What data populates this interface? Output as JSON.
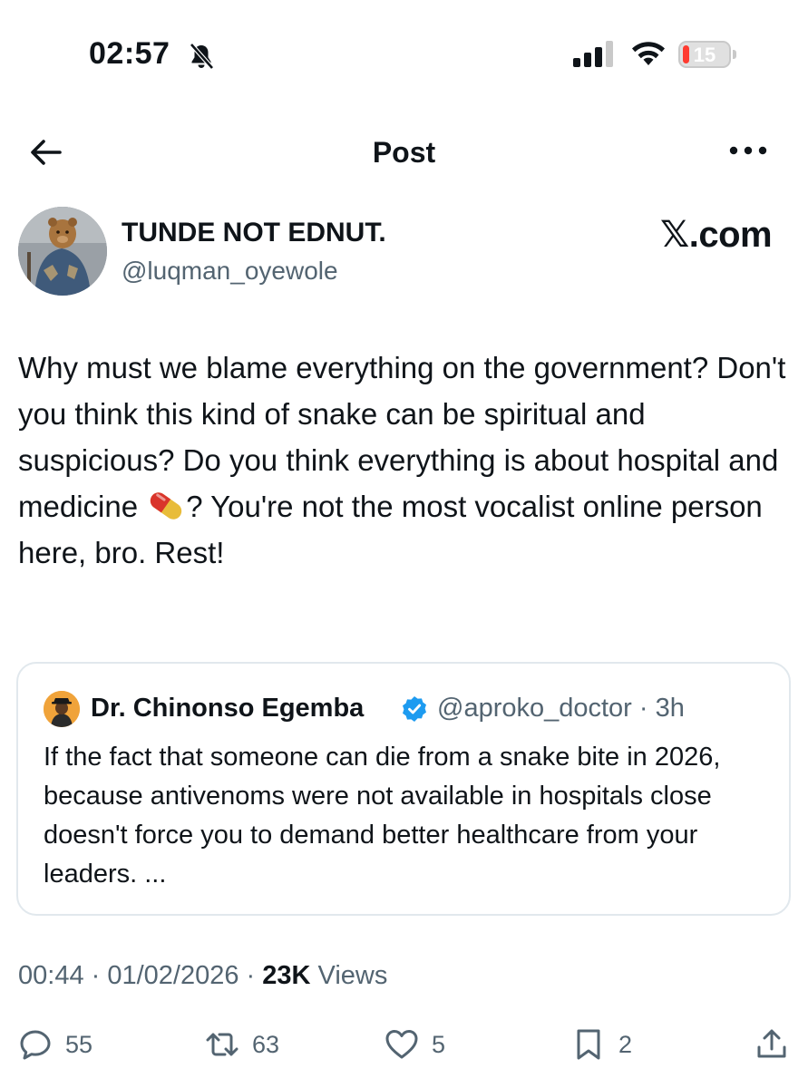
{
  "status_bar": {
    "time": "02:57",
    "battery_level": "15"
  },
  "header": {
    "title": "Post"
  },
  "author": {
    "name": "TUNDE NOT EDNUT.",
    "handle": "@luqman_oyewole",
    "brand": "𝕏.com"
  },
  "tweet": {
    "text_before_emoji": "Why must we blame everything on the government? Don't you think this kind of snake can be spiritual and suspicious? Do you think everything is about hospital and medicine ",
    "text_after_emoji": "? You're not the most vocalist online person here, bro. Rest!"
  },
  "quote": {
    "name": "Dr. Chinonso Egemba",
    "handle_time": "@aproko_doctor · 3h",
    "text": "If the fact that someone can die from a snake bite in 2026, because antivenoms were not available in hospitals close doesn't force you to demand better healthcare from your leaders. ..."
  },
  "meta": {
    "time_date": "00:44 · 01/02/2026 · ",
    "views_count": "23K",
    "views_label": " Views"
  },
  "actions": {
    "replies": "55",
    "reposts": "63",
    "likes": "5",
    "bookmarks": "2"
  },
  "colors": {
    "text": "#0f1419",
    "secondary": "#536471",
    "verified": "#1d9bf0",
    "border": "#e1e8ed"
  }
}
